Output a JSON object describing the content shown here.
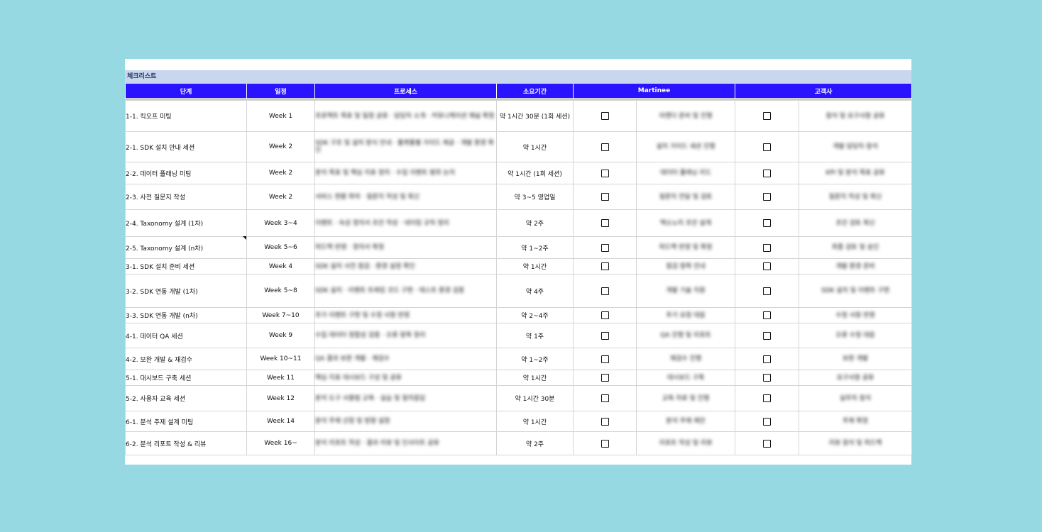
{
  "sheet": {
    "section_title": "체크리스트",
    "headers": {
      "step": "단계",
      "schedule": "일정",
      "process": "프로세스",
      "duration": "소요기간",
      "vendor": "Martinee",
      "client": "고객사"
    },
    "rows": [
      {
        "step": "1-1. 킥오프 미팅",
        "week": "Week 1",
        "process": "프로젝트 목표 및 일정 공유 · 담당자 소개 · 커뮤니케이션 채널 확정",
        "duration": "약 1시간 30분 (1회 세션)",
        "vendor_note": "아젠다 준비 및 진행",
        "client_note": "참석 및 요구사항 공유",
        "vendor_checked": false,
        "client_checked": false
      },
      {
        "step": "2-1. SDK 설치 안내 세션",
        "week": "Week 2",
        "process": "SDK 구조 및 설치 방식 안내 · 플랫폼별 가이드 제공 · 개발 환경 확인",
        "duration": "약 1시간",
        "vendor_note": "설치 가이드 세션 진행",
        "client_note": "개발 담당자 참석",
        "vendor_checked": false,
        "client_checked": false
      },
      {
        "step": "2-2. 데이터 플래닝 미팅",
        "week": "Week 2",
        "process": "분석 목표 및 핵심 지표 정의 · 수집 이벤트 범위 논의",
        "duration": "약 1시간 (1회 세션)",
        "vendor_note": "데이터 플래닝 리드",
        "client_note": "KPI 및 분석 목표 공유",
        "vendor_checked": false,
        "client_checked": false
      },
      {
        "step": "2-3. 사전 질문지 작성",
        "week": "Week 2",
        "process": "서비스 현황 파악 · 질문지 작성 및 회신",
        "duration": "약 3~5 영업일",
        "vendor_note": "질문지 전달 및 검토",
        "client_note": "질문지 작성 및 회신",
        "vendor_checked": false,
        "client_checked": false
      },
      {
        "step": "2-4. Taxonomy 설계 (1차)",
        "week": "Week 3~4",
        "process": "이벤트 · 속성 정의서 초안 작성 · 네이밍 규칙 정리",
        "duration": "약 2주",
        "vendor_note": "택소노미 초안 설계",
        "client_note": "초안 검토 회신",
        "vendor_checked": false,
        "client_checked": false
      },
      {
        "step": "2-5. Taxonomy 설계 (n차)",
        "week": "Week 5~6",
        "process": "피드백 반영 · 정의서 확정",
        "duration": "약 1~2주",
        "vendor_note": "피드백 반영 및 확정",
        "client_note": "최종 검토 및 승인",
        "vendor_checked": false,
        "client_checked": false
      },
      {
        "step": "3-1. SDK 설치 준비 세션",
        "week": "Week 4",
        "process": "SDK 설치 사전 점검 · 환경 설정 확인",
        "duration": "약 1시간",
        "vendor_note": "점검 항목 안내",
        "client_note": "개발 환경 준비",
        "vendor_checked": false,
        "client_checked": false
      },
      {
        "step": "3-2. SDK 연동 개발 (1차)",
        "week": "Week 5~8",
        "process": "SDK 설치 · 이벤트 트래킹 코드 구현 · 테스트 환경 검증",
        "duration": "약 4주",
        "vendor_note": "개발 기술 지원",
        "client_note": "SDK 설치 및 이벤트 구현",
        "vendor_checked": false,
        "client_checked": false
      },
      {
        "step": "3-3. SDK 연동 개발 (n차)",
        "week": "Week 7~10",
        "process": "추가 이벤트 구현 및 수정 사항 반영",
        "duration": "약 2~4주",
        "vendor_note": "추가 요청 대응",
        "client_note": "수정 사항 반영",
        "vendor_checked": false,
        "client_checked": false
      },
      {
        "step": "4-1. 데이터 QA 세션",
        "week": "Week 9",
        "process": "수집 데이터 정합성 검증 · 오류 항목 정리",
        "duration": "약 1주",
        "vendor_note": "QA 진행 및 리포트",
        "client_note": "오류 수정 대응",
        "vendor_checked": false,
        "client_checked": false
      },
      {
        "step": "4-2. 보완 개발 & 재검수",
        "week": "Week 10~11",
        "process": "QA 결과 보완 개발 · 재검수",
        "duration": "약 1~2주",
        "vendor_note": "재검수 진행",
        "client_note": "보완 개발",
        "vendor_checked": false,
        "client_checked": false
      },
      {
        "step": "5-1. 대시보드 구축 세션",
        "week": "Week 11",
        "process": "핵심 지표 대시보드 구성 및 공유",
        "duration": "약 1시간",
        "vendor_note": "대시보드 구축",
        "client_note": "요구사항 공유",
        "vendor_checked": false,
        "client_checked": false
      },
      {
        "step": "5-2. 사용자 교육 세션",
        "week": "Week 12",
        "process": "분석 도구 사용법 교육 · 실습 및 질의응답",
        "duration": "약 1시간 30분",
        "vendor_note": "교육 자료 및 진행",
        "client_note": "실무자 참석",
        "vendor_checked": false,
        "client_checked": false
      },
      {
        "step": "6-1. 분석 주제 설계 미팅",
        "week": "Week 14",
        "process": "분석 주제 선정 및 방향 설정",
        "duration": "약 1시간",
        "vendor_note": "분석 주제 제안",
        "client_note": "주제 확정",
        "vendor_checked": false,
        "client_checked": false
      },
      {
        "step": "6-2. 분석 리포트 작성 & 리뷰",
        "week": "Week 16~",
        "process": "분석 리포트 작성 · 결과 리뷰 및 인사이트 공유",
        "duration": "약 2주",
        "vendor_note": "리포트 작성 및 리뷰",
        "client_note": "리뷰 참석 및 피드백",
        "vendor_checked": false,
        "client_checked": false
      }
    ]
  }
}
